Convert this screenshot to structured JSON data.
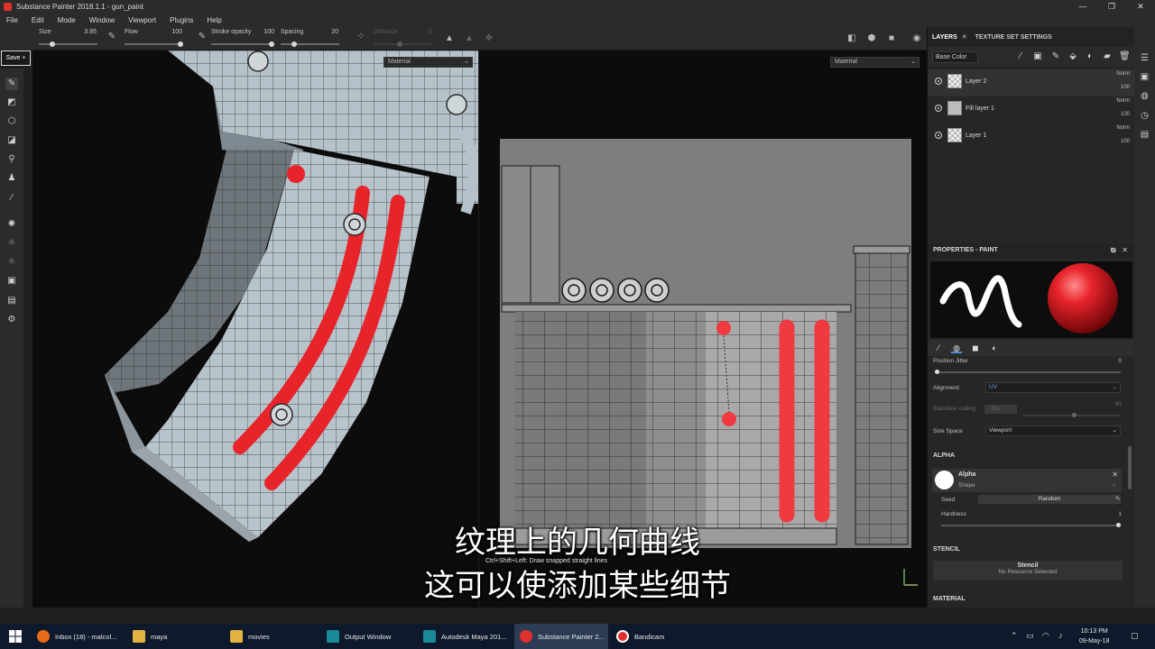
{
  "window": {
    "title": "Substance Painter 2018.1.1 - gun_paint",
    "controls": [
      "—",
      "❐",
      "✕"
    ]
  },
  "menu": [
    "File",
    "Edit",
    "Mode",
    "Window",
    "Viewport",
    "Plugins",
    "Help"
  ],
  "tool_options": {
    "size_label": "Size",
    "size_value": "3.85",
    "flow_label": "Flow",
    "flow_value": "100",
    "stroke_opacity_label": "Stroke opacity",
    "stroke_opacity_value": "100",
    "spacing_label": "Spacing",
    "spacing_value": "20",
    "distance_label": "Distance",
    "distance_value": "0"
  },
  "save_button": "Save +",
  "viewports": {
    "left_material": "Material",
    "right_material": "Material"
  },
  "subtitles": {
    "line1": "纹理上的几何曲线",
    "line2": "这可以使添加某些细节"
  },
  "hint": "Ctrl+Shift+Left: Draw snapped straight lines",
  "layers_panel": {
    "tab_layers": "LAYERS",
    "tab_texture_set": "TEXTURE SET SETTINGS",
    "channel": "Base Color",
    "layers": [
      {
        "name": "Layer 2",
        "blend": "Norm",
        "opacity": "100",
        "thumb": "checker"
      },
      {
        "name": "Fill layer 1",
        "blend": "Norm",
        "opacity": "100",
        "thumb": "fill"
      },
      {
        "name": "Layer 1",
        "blend": "Norm",
        "opacity": "100",
        "thumb": "checker"
      }
    ]
  },
  "properties": {
    "header": "PROPERTIES - PAINT",
    "position_jitter_label": "Position Jitter",
    "position_jitter_value": "0",
    "alignment_label": "Alignment",
    "alignment_value": "UV",
    "backface_label": "Backface culling",
    "backface_toggle": "On",
    "backface_value": "90",
    "size_space_label": "Size Space",
    "size_space_value": "Viewport",
    "alpha_section": "ALPHA",
    "alpha_name": "Alpha",
    "alpha_type": "Shape",
    "seed_label": "Seed",
    "seed_button": "Random",
    "hardness_label": "Hardness",
    "hardness_value": "1",
    "stencil_section": "STENCIL",
    "stencil_title": "Stencil",
    "stencil_sub": "No Resource Selected",
    "material_section": "MATERIAL"
  },
  "taskbar": {
    "items": [
      "Inbox (18) - malcol...",
      "maya",
      "movies",
      "Output Window",
      "Autodesk Maya 201...",
      "Substance Painter 2...",
      "Bandicam"
    ],
    "time": "10:13 PM",
    "date": "09-May-18"
  },
  "colors": {
    "accent_red": "#e8242b",
    "mesh_light": "#b4c0c8",
    "uv_gray": "#808080",
    "selection_blue": "#4a90d9"
  }
}
